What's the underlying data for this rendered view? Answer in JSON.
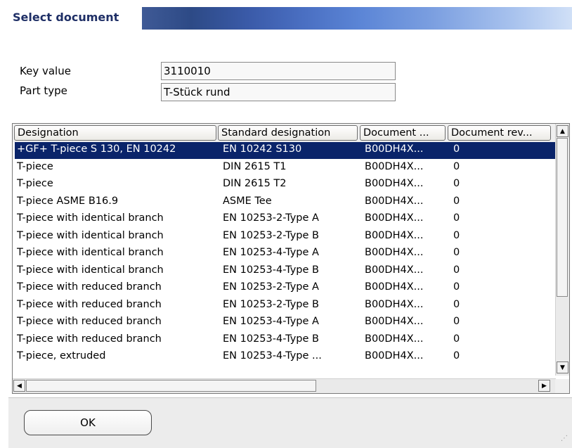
{
  "window": {
    "title": "Select document"
  },
  "fields": {
    "key_value": {
      "label": "Key value",
      "value": "3110010"
    },
    "part_type": {
      "label": "Part type",
      "value": "T-Stück rund"
    }
  },
  "table": {
    "headers": [
      "Designation",
      "Standard designation",
      "Document ...",
      "Document rev..."
    ],
    "rows": [
      [
        "+GF+ T-piece S 130, EN 10242",
        "EN 10242 S130",
        "B00DH4X...",
        "0"
      ],
      [
        "T-piece",
        "DIN 2615 T1",
        "B00DH4X...",
        "0"
      ],
      [
        "T-piece",
        "DIN 2615 T2",
        "B00DH4X...",
        "0"
      ],
      [
        "T-piece ASME B16.9",
        "ASME Tee",
        "B00DH4X...",
        "0"
      ],
      [
        "T-piece with identical branch",
        "EN 10253-2-Type A",
        "B00DH4X...",
        "0"
      ],
      [
        "T-piece with identical branch",
        "EN 10253-2-Type B",
        "B00DH4X...",
        "0"
      ],
      [
        "T-piece with identical branch",
        "EN 10253-4-Type A",
        "B00DH4X...",
        "0"
      ],
      [
        "T-piece with identical branch",
        "EN 10253-4-Type B",
        "B00DH4X...",
        "0"
      ],
      [
        "T-piece with reduced branch",
        "EN 10253-2-Type A",
        "B00DH4X...",
        "0"
      ],
      [
        "T-piece with reduced branch",
        "EN 10253-2-Type B",
        "B00DH4X...",
        "0"
      ],
      [
        "T-piece with reduced branch",
        "EN 10253-4-Type A",
        "B00DH4X...",
        "0"
      ],
      [
        "T-piece with reduced branch",
        "EN 10253-4-Type B",
        "B00DH4X...",
        "0"
      ],
      [
        "T-piece, extruded",
        "EN 10253-4-Type ...",
        "B00DH4X...",
        "0"
      ]
    ],
    "selected_row": 0
  },
  "buttons": {
    "ok": "OK"
  },
  "colors": {
    "selection": "#0a246a",
    "title_text": "#1f2f66"
  }
}
